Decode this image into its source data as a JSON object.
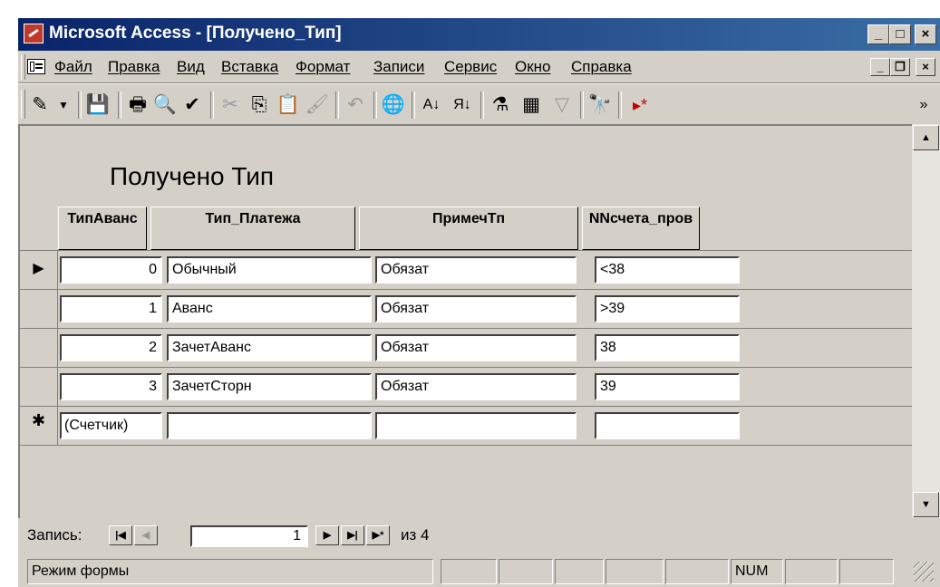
{
  "window": {
    "title": "Microsoft Access - [Получено_Тип]",
    "caption_buttons": {
      "minimize": "_",
      "maximize": "□",
      "close": "×"
    }
  },
  "menubar": {
    "items": [
      "Файл",
      "Правка",
      "Вид",
      "Вставка",
      "Формат",
      "Записи",
      "Сервис",
      "Окно",
      "Справка"
    ],
    "mdi_buttons": {
      "minimize": "_",
      "restore": "❐",
      "close": "×"
    }
  },
  "toolbar": {
    "icons": [
      "design-view-icon",
      "save-icon",
      "print-icon",
      "print-preview-icon",
      "spelling-icon",
      "cut-icon",
      "copy-icon",
      "paste-icon",
      "format-painter-icon",
      "undo-icon",
      "hyperlink-icon",
      "sort-ascending-icon",
      "sort-descending-icon",
      "filter-by-selection-icon",
      "filter-by-form-icon",
      "apply-filter-icon",
      "find-icon",
      "new-record-icon",
      "more-icon"
    ]
  },
  "form": {
    "title": "Получено Тип",
    "columns": [
      "ТипАванс",
      "Тип_Платежа",
      "ПримечТп",
      "NNсчета_пров"
    ],
    "rows": [
      {
        "tip_avans": "0",
        "tip_platezha": "Обычный",
        "primech": "Обязат",
        "nn": "<38"
      },
      {
        "tip_avans": "1",
        "tip_platezha": "Аванс",
        "primech": "Обязат",
        "nn": ">39"
      },
      {
        "tip_avans": "2",
        "tip_platezha": "ЗачетАванс",
        "primech": "Обязат",
        "nn": "38"
      },
      {
        "tip_avans": "3",
        "tip_platezha": "ЗачетСторн",
        "primech": "Обязат",
        "nn": "39"
      }
    ],
    "new_row": {
      "tip_avans": "(Счетчик)",
      "tip_platezha": "",
      "primech": "",
      "nn": ""
    },
    "selectors": {
      "current": "▶",
      "new": "✱"
    }
  },
  "navigation": {
    "label": "Запись:",
    "current_record": "1",
    "total": "из 4"
  },
  "statusbar": {
    "mode": "Режим формы",
    "num": "NUM"
  },
  "colors": {
    "titlebar_start": "#0a246a",
    "titlebar_end": "#3a6ea5",
    "face": "#d4d0c8"
  }
}
